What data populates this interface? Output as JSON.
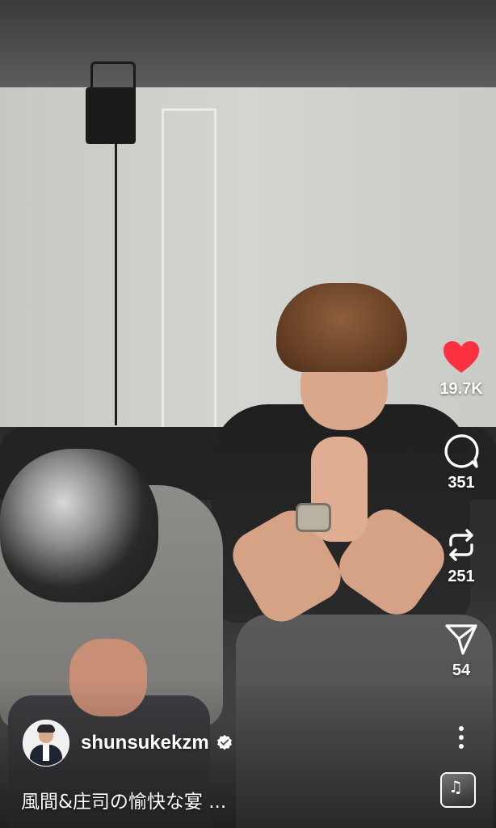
{
  "post": {
    "username": "shunsukekzm",
    "verified": true,
    "caption": "風間&庄司の愉快な宴 ..."
  },
  "actions": {
    "like": {
      "icon": "heart-filled-icon",
      "count": "19.7K",
      "liked": true,
      "color": "#ff3040"
    },
    "comment": {
      "icon": "comment-bubble-icon",
      "count": "351"
    },
    "repost": {
      "icon": "repost-icon",
      "count": "251"
    },
    "share": {
      "icon": "send-icon",
      "count": "54"
    },
    "more": {
      "icon": "more-vertical-icon"
    },
    "audio": {
      "icon": "original-audio-thumbnail-icon"
    }
  }
}
